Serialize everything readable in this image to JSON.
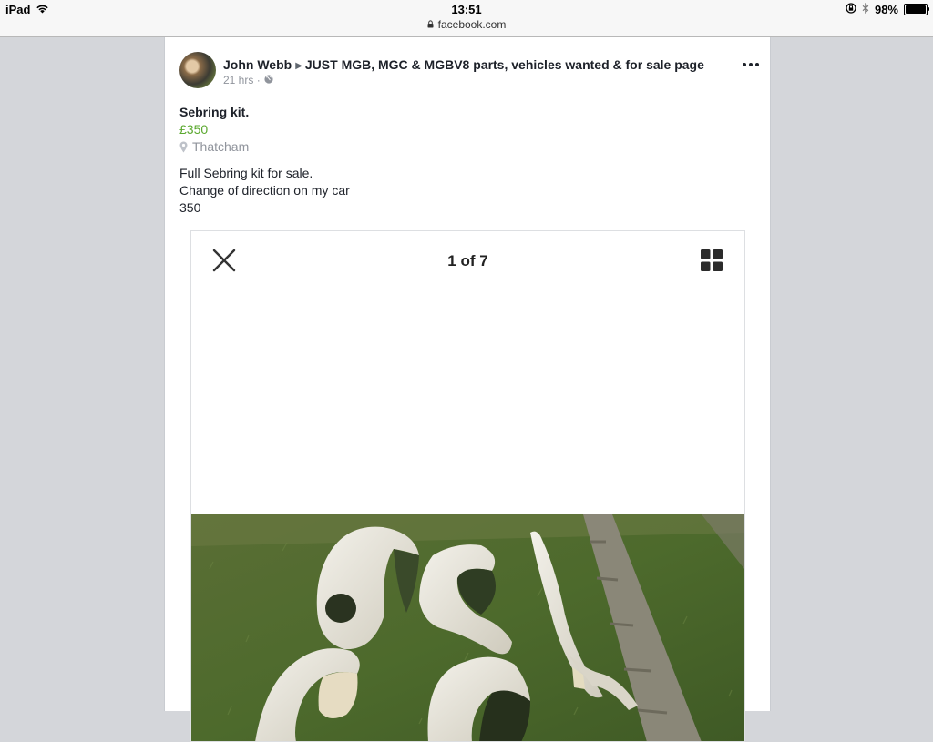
{
  "status_bar": {
    "device": "iPad",
    "time": "13:51",
    "url": "facebook.com",
    "battery": "98%",
    "battery_level": 0.98
  },
  "post": {
    "author": "John Webb",
    "group": "JUST MGB, MGC & MGBV8 parts, vehicles wanted & for sale page",
    "timestamp": "21 hrs",
    "separator": "·",
    "listing": {
      "title": "Sebring kit.",
      "price": "£350",
      "location": "Thatcham"
    },
    "description": [
      "Full Sebring kit for sale.",
      "Change of direction on my car",
      "350"
    ],
    "viewer": {
      "counter": "1 of 7"
    }
  },
  "colors": {
    "price": "#5aa82e",
    "background": "#d4d6da",
    "secondary_text": "#90949c"
  },
  "icons": [
    "wifi-icon",
    "lock-icon",
    "orientation-lock-icon",
    "bluetooth-icon",
    "battery-icon",
    "globe-icon",
    "location-pin-icon",
    "more-icon",
    "close-icon",
    "grid-icon"
  ]
}
